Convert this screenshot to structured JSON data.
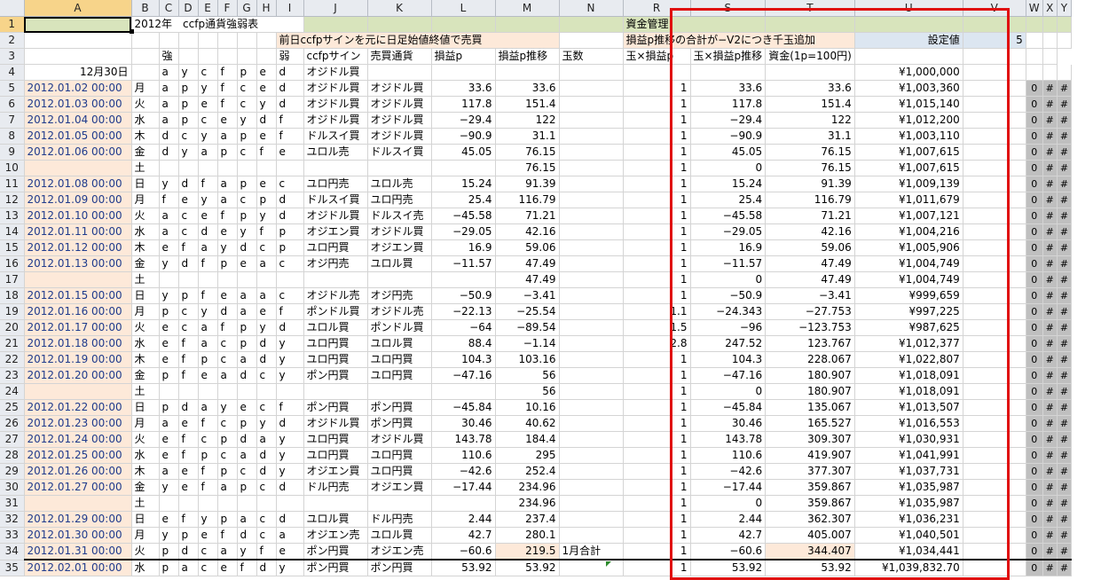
{
  "columns": [
    "A",
    "B",
    "C",
    "D",
    "E",
    "F",
    "G",
    "H",
    "I",
    "J",
    "K",
    "L",
    "M",
    "N",
    "R",
    "S",
    "T",
    "U",
    "V",
    "W",
    "X",
    "Y"
  ],
  "row1": {
    "title": "2012年　ccfp通貨強弱表",
    "money_title": "資金管理"
  },
  "row2": {
    "strategy": "前日ccfpサインを元に日足始値終値で売買",
    "rule": "損益p推移の合計が−V2につき千玉追加",
    "setting_label": "設定値",
    "setting_value": "5"
  },
  "row3": {
    "strong": "強",
    "weak": "弱",
    "sign": "ccfpサイン",
    "pair": "売買通貨",
    "pnl": "損益p",
    "cum": "損益p推移",
    "lots": "玉数",
    "lot_pnl": "玉×損益p",
    "lot_cum": "玉×損益p推移",
    "funds": "資金(1p=100円)"
  },
  "row4": {
    "date": "12月30日",
    "c": "a",
    "d": "y",
    "e": "c",
    "f": "f",
    "g": "p",
    "h": "e",
    "i": "d",
    "sign": "オジドル買",
    "funds": "¥1,000,000"
  },
  "note_n34": "1月合計",
  "rows": [
    {
      "n": "5",
      "date": "2012.01.02 00:00",
      "wd": "月",
      "s": [
        "a",
        "p",
        "y",
        "f",
        "c",
        "e",
        "d"
      ],
      "sign": "オジドル買",
      "pair": "オジドル買",
      "pnl": "33.6",
      "cum": "33.6",
      "lots": "1",
      "lp": "33.6",
      "lc": "33.6",
      "funds": "¥1,003,360"
    },
    {
      "n": "6",
      "date": "2012.01.03 00:00",
      "wd": "火",
      "s": [
        "a",
        "p",
        "e",
        "f",
        "c",
        "y",
        "d"
      ],
      "sign": "オジドル買",
      "pair": "オジドル買",
      "pnl": "117.8",
      "cum": "151.4",
      "lots": "1",
      "lp": "117.8",
      "lc": "151.4",
      "funds": "¥1,015,140"
    },
    {
      "n": "7",
      "date": "2012.01.04 00:00",
      "wd": "水",
      "s": [
        "a",
        "p",
        "c",
        "e",
        "y",
        "d",
        "f"
      ],
      "sign": "オジドル買",
      "pair": "オジドル買",
      "pnl": "−29.4",
      "cum": "122",
      "lots": "1",
      "lp": "−29.4",
      "lc": "122",
      "funds": "¥1,012,200"
    },
    {
      "n": "8",
      "date": "2012.01.05 00:00",
      "wd": "木",
      "s": [
        "d",
        "c",
        "y",
        "a",
        "p",
        "e",
        "f"
      ],
      "sign": "ドルスイ買",
      "pair": "オジドル買",
      "pnl": "−90.9",
      "cum": "31.1",
      "lots": "1",
      "lp": "−90.9",
      "lc": "31.1",
      "funds": "¥1,003,110"
    },
    {
      "n": "9",
      "date": "2012.01.06 00:00",
      "wd": "金",
      "s": [
        "d",
        "y",
        "a",
        "p",
        "c",
        "f",
        "e"
      ],
      "sign": "ユロル売",
      "pair": "ドルスイ買",
      "pnl": "45.05",
      "cum": "76.15",
      "lots": "1",
      "lp": "45.05",
      "lc": "76.15",
      "funds": "¥1,007,615"
    },
    {
      "n": "10",
      "date": "",
      "wd": "土",
      "s": [
        "",
        "",
        "",
        "",
        "",
        "",
        ""
      ],
      "sign": "",
      "pair": "",
      "pnl": "",
      "cum": "76.15",
      "lots": "1",
      "lp": "0",
      "lc": "76.15",
      "funds": "¥1,007,615"
    },
    {
      "n": "11",
      "date": "2012.01.08 00:00",
      "wd": "日",
      "s": [
        "y",
        "d",
        "f",
        "a",
        "p",
        "e",
        "c"
      ],
      "sign": "ユロ円売",
      "pair": "ユロル売",
      "pnl": "15.24",
      "cum": "91.39",
      "lots": "1",
      "lp": "15.24",
      "lc": "91.39",
      "funds": "¥1,009,139"
    },
    {
      "n": "12",
      "date": "2012.01.09 00:00",
      "wd": "月",
      "s": [
        "f",
        "e",
        "y",
        "a",
        "c",
        "p",
        "d"
      ],
      "sign": "ドルスイ買",
      "pair": "ユロ円売",
      "pnl": "25.4",
      "cum": "116.79",
      "lots": "1",
      "lp": "25.4",
      "lc": "116.79",
      "funds": "¥1,011,679"
    },
    {
      "n": "13",
      "date": "2012.01.10 00:00",
      "wd": "火",
      "s": [
        "a",
        "c",
        "e",
        "f",
        "p",
        "y",
        "d"
      ],
      "sign": "オジドル買",
      "pair": "ドルスイ売",
      "pnl": "−45.58",
      "cum": "71.21",
      "lots": "1",
      "lp": "−45.58",
      "lc": "71.21",
      "funds": "¥1,007,121"
    },
    {
      "n": "14",
      "date": "2012.01.11 00:00",
      "wd": "水",
      "s": [
        "a",
        "c",
        "d",
        "e",
        "y",
        "f",
        "p"
      ],
      "sign": "オジエン買",
      "pair": "オジドル買",
      "pnl": "−29.05",
      "cum": "42.16",
      "lots": "1",
      "lp": "−29.05",
      "lc": "42.16",
      "funds": "¥1,004,216"
    },
    {
      "n": "15",
      "date": "2012.01.12 00:00",
      "wd": "木",
      "s": [
        "e",
        "f",
        "a",
        "y",
        "d",
        "c",
        "p"
      ],
      "sign": "ユロ円買",
      "pair": "オジエン買",
      "pnl": "16.9",
      "cum": "59.06",
      "lots": "1",
      "lp": "16.9",
      "lc": "59.06",
      "funds": "¥1,005,906"
    },
    {
      "n": "16",
      "date": "2012.01.13 00:00",
      "wd": "金",
      "s": [
        "y",
        "d",
        "f",
        "p",
        "e",
        "a",
        "c"
      ],
      "sign": "オジ円売",
      "pair": "ユロル買",
      "pnl": "−11.57",
      "cum": "47.49",
      "lots": "1",
      "lp": "−11.57",
      "lc": "47.49",
      "funds": "¥1,004,749"
    },
    {
      "n": "17",
      "date": "",
      "wd": "土",
      "s": [
        "",
        "",
        "",
        "",
        "",
        "",
        ""
      ],
      "sign": "",
      "pair": "",
      "pnl": "",
      "cum": "47.49",
      "lots": "1",
      "lp": "0",
      "lc": "47.49",
      "funds": "¥1,004,749"
    },
    {
      "n": "18",
      "date": "2012.01.15 00:00",
      "wd": "日",
      "s": [
        "y",
        "p",
        "f",
        "e",
        "a",
        "a",
        "c"
      ],
      "sign": "オジドル売",
      "pair": "オジ円売",
      "pnl": "−50.9",
      "cum": "−3.41",
      "lots": "1",
      "lp": "−50.9",
      "lc": "−3.41",
      "funds": "¥999,659"
    },
    {
      "n": "19",
      "date": "2012.01.16 00:00",
      "wd": "月",
      "s": [
        "p",
        "c",
        "y",
        "d",
        "a",
        "e",
        "f"
      ],
      "sign": "ポンドル買",
      "pair": "オジドル売",
      "pnl": "−22.13",
      "cum": "−25.54",
      "lots": "1.1",
      "lp": "−24.343",
      "lc": "−27.753",
      "funds": "¥997,225"
    },
    {
      "n": "20",
      "date": "2012.01.17 00:00",
      "wd": "火",
      "s": [
        "e",
        "c",
        "a",
        "f",
        "p",
        "y",
        "d"
      ],
      "sign": "ユロル買",
      "pair": "ポンドル買",
      "pnl": "−64",
      "cum": "−89.54",
      "lots": "1.5",
      "lp": "−96",
      "lc": "−123.753",
      "funds": "¥987,625"
    },
    {
      "n": "21",
      "date": "2012.01.18 00:00",
      "wd": "水",
      "s": [
        "e",
        "f",
        "a",
        "c",
        "p",
        "d",
        "y"
      ],
      "sign": "ユロ円買",
      "pair": "ユロル買",
      "pnl": "88.4",
      "cum": "−1.14",
      "lots": "2.8",
      "lp": "247.52",
      "lc": "123.767",
      "funds": "¥1,012,377"
    },
    {
      "n": "22",
      "date": "2012.01.19 00:00",
      "wd": "木",
      "s": [
        "e",
        "f",
        "p",
        "c",
        "a",
        "d",
        "y"
      ],
      "sign": "ユロ円買",
      "pair": "ユロ円買",
      "pnl": "104.3",
      "cum": "103.16",
      "lots": "1",
      "lp": "104.3",
      "lc": "228.067",
      "funds": "¥1,022,807"
    },
    {
      "n": "23",
      "date": "2012.01.20 00:00",
      "wd": "金",
      "s": [
        "p",
        "f",
        "e",
        "a",
        "d",
        "c",
        "y"
      ],
      "sign": "ポン円買",
      "pair": "ユロ円買",
      "pnl": "−47.16",
      "cum": "56",
      "lots": "1",
      "lp": "−47.16",
      "lc": "180.907",
      "funds": "¥1,018,091"
    },
    {
      "n": "24",
      "date": "",
      "wd": "土",
      "s": [
        "",
        "",
        "",
        "",
        "",
        "",
        ""
      ],
      "sign": "",
      "pair": "",
      "pnl": "",
      "cum": "56",
      "lots": "1",
      "lp": "0",
      "lc": "180.907",
      "funds": "¥1,018,091"
    },
    {
      "n": "25",
      "date": "2012.01.22 00:00",
      "wd": "日",
      "s": [
        "p",
        "d",
        "a",
        "y",
        "e",
        "c",
        "f"
      ],
      "sign": "ポン円買",
      "pair": "ポン円買",
      "pnl": "−45.84",
      "cum": "10.16",
      "lots": "1",
      "lp": "−45.84",
      "lc": "135.067",
      "funds": "¥1,013,507"
    },
    {
      "n": "26",
      "date": "2012.01.23 00:00",
      "wd": "月",
      "s": [
        "a",
        "e",
        "f",
        "c",
        "p",
        "y",
        "d"
      ],
      "sign": "オジドル買",
      "pair": "ポン円買",
      "pnl": "30.46",
      "cum": "40.62",
      "lots": "1",
      "lp": "30.46",
      "lc": "165.527",
      "funds": "¥1,016,553"
    },
    {
      "n": "27",
      "date": "2012.01.24 00:00",
      "wd": "火",
      "s": [
        "e",
        "f",
        "c",
        "p",
        "d",
        "a",
        "y"
      ],
      "sign": "ユロ円買",
      "pair": "オジドル買",
      "pnl": "143.78",
      "cum": "184.4",
      "lots": "1",
      "lp": "143.78",
      "lc": "309.307",
      "funds": "¥1,030,931"
    },
    {
      "n": "28",
      "date": "2012.01.25 00:00",
      "wd": "水",
      "s": [
        "e",
        "f",
        "p",
        "c",
        "a",
        "d",
        "y"
      ],
      "sign": "ユロ円買",
      "pair": "ユロ円買",
      "pnl": "110.6",
      "cum": "295",
      "lots": "1",
      "lp": "110.6",
      "lc": "419.907",
      "funds": "¥1,041,991"
    },
    {
      "n": "29",
      "date": "2012.01.26 00:00",
      "wd": "木",
      "s": [
        "a",
        "e",
        "f",
        "p",
        "c",
        "d",
        "y"
      ],
      "sign": "オジエン買",
      "pair": "ユロ円買",
      "pnl": "−42.6",
      "cum": "252.4",
      "lots": "1",
      "lp": "−42.6",
      "lc": "377.307",
      "funds": "¥1,037,731"
    },
    {
      "n": "30",
      "date": "2012.01.27 00:00",
      "wd": "金",
      "s": [
        "y",
        "e",
        "f",
        "a",
        "p",
        "c",
        "d"
      ],
      "sign": "ドル円売",
      "pair": "オジエン買",
      "pnl": "−17.44",
      "cum": "234.96",
      "lots": "1",
      "lp": "−17.44",
      "lc": "359.867",
      "funds": "¥1,035,987"
    },
    {
      "n": "31",
      "date": "",
      "wd": "土",
      "s": [
        "",
        "",
        "",
        "",
        "",
        "",
        ""
      ],
      "sign": "",
      "pair": "",
      "pnl": "",
      "cum": "234.96",
      "lots": "1",
      "lp": "0",
      "lc": "359.867",
      "funds": "¥1,035,987"
    },
    {
      "n": "32",
      "date": "2012.01.29 00:00",
      "wd": "日",
      "s": [
        "e",
        "f",
        "y",
        "p",
        "a",
        "c",
        "d"
      ],
      "sign": "ユロル買",
      "pair": "ドル円売",
      "pnl": "2.44",
      "cum": "237.4",
      "lots": "1",
      "lp": "2.44",
      "lc": "362.307",
      "funds": "¥1,036,231"
    },
    {
      "n": "33",
      "date": "2012.01.30 00:00",
      "wd": "月",
      "s": [
        "y",
        "p",
        "e",
        "f",
        "d",
        "c",
        "a"
      ],
      "sign": "オジエン売",
      "pair": "ユロル買",
      "pnl": "42.7",
      "cum": "280.1",
      "lots": "1",
      "lp": "42.7",
      "lc": "405.007",
      "funds": "¥1,040,501"
    },
    {
      "n": "34",
      "date": "2012.01.31 00:00",
      "wd": "火",
      "s": [
        "p",
        "d",
        "c",
        "a",
        "y",
        "f",
        "e"
      ],
      "sign": "ポン円買",
      "pair": "オジエン売",
      "pnl": "−60.6",
      "cum": "219.5",
      "lots": "1",
      "lp": "−60.6",
      "lc": "344.407",
      "funds": "¥1,034,441"
    },
    {
      "n": "35",
      "date": "2012.02.01 00:00",
      "wd": "水",
      "s": [
        "p",
        "a",
        "c",
        "e",
        "f",
        "d",
        "y"
      ],
      "sign": "ポン円買",
      "pair": "ポン円買",
      "pnl": "53.92",
      "cum": "53.92",
      "lots": "1",
      "lp": "53.92",
      "lc": "53.92",
      "funds": "¥1,039,832.70"
    }
  ],
  "gray_cols": {
    "w": "0",
    "x": "#",
    "y": "#"
  }
}
